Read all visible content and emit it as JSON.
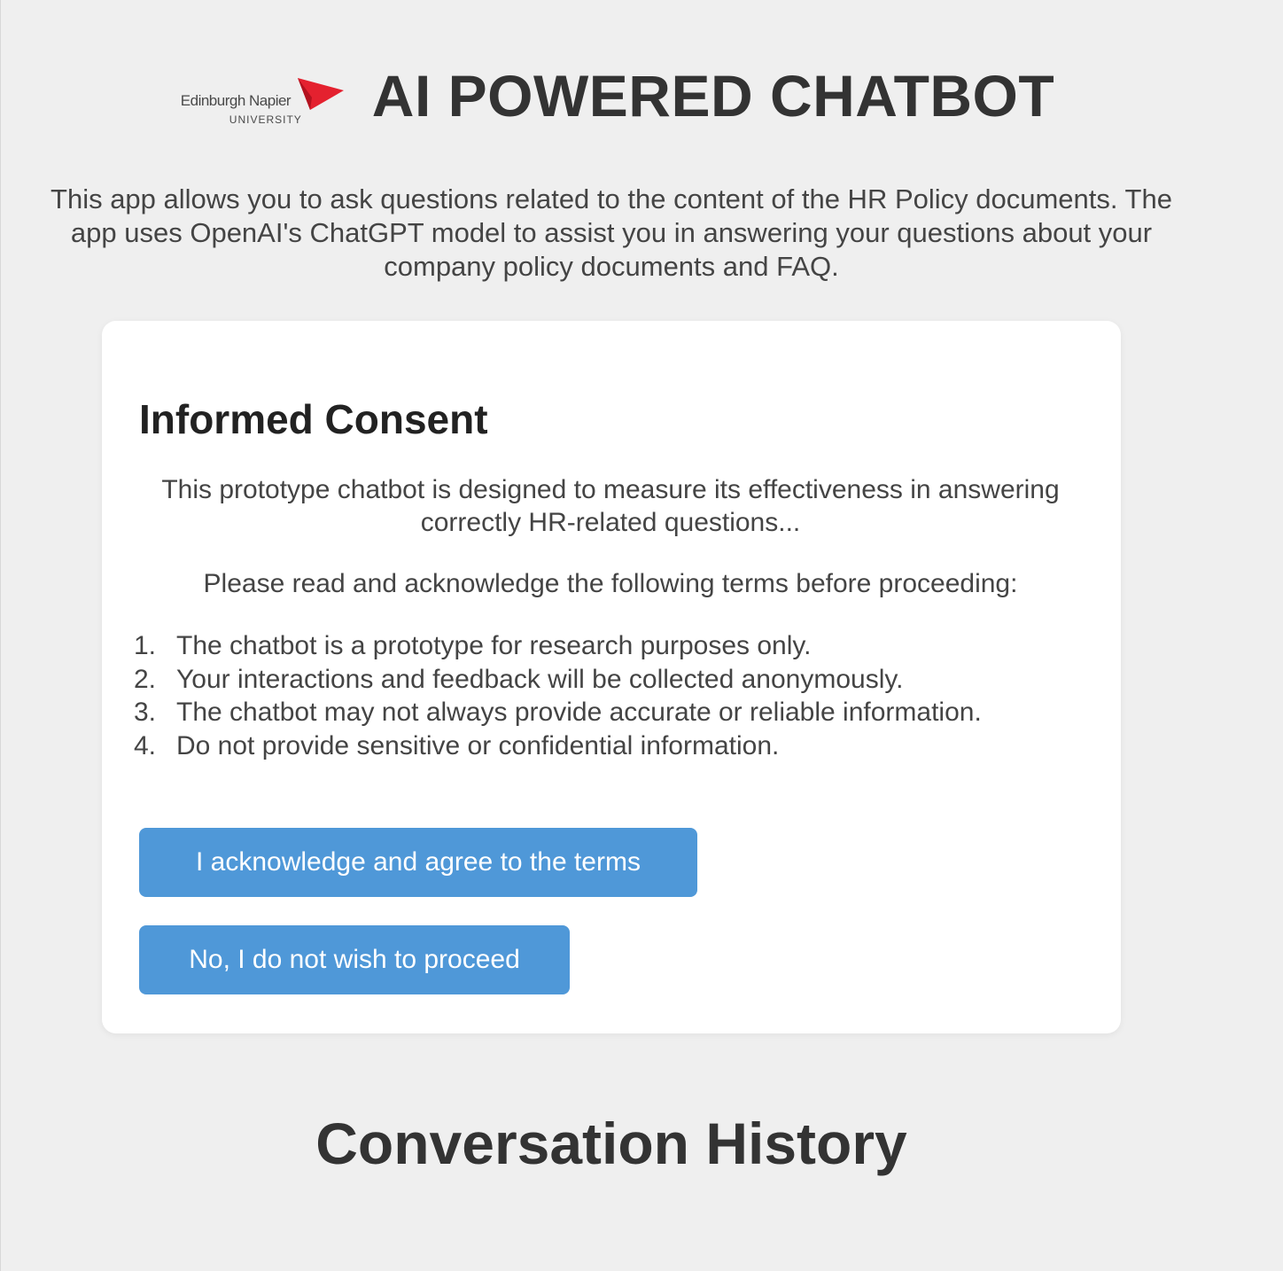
{
  "header": {
    "logo_name": "Edinburgh Napier",
    "logo_sub": "UNIVERSITY",
    "title": "AI POWERED CHATBOT"
  },
  "intro": "This app allows you to ask questions related to the content of the HR Policy documents. The app uses OpenAI's ChatGPT model to assist you in answering your questions about your company policy documents and FAQ.",
  "consent": {
    "title": "Informed Consent",
    "description": "This prototype chatbot is designed to measure its effectiveness in answering correctly HR-related questions...",
    "instruction": "Please read and acknowledge the following terms before proceeding:",
    "terms": [
      {
        "num": "1.",
        "text": "The chatbot is a prototype for research purposes only."
      },
      {
        "num": "2.",
        "text": "Your interactions and feedback will be collected anonymously."
      },
      {
        "num": "3.",
        "text": "The chatbot may not always provide accurate or reliable information."
      },
      {
        "num": "4.",
        "text": "Do not provide sensitive or confidential information."
      }
    ],
    "agree_label": "I acknowledge and agree to the terms",
    "decline_label": "No, I do not wish to proceed"
  },
  "history": {
    "title": "Conversation History"
  },
  "colors": {
    "background": "#efefef",
    "card": "#ffffff",
    "button": "#4f98d8",
    "logo_red": "#e4212f"
  }
}
